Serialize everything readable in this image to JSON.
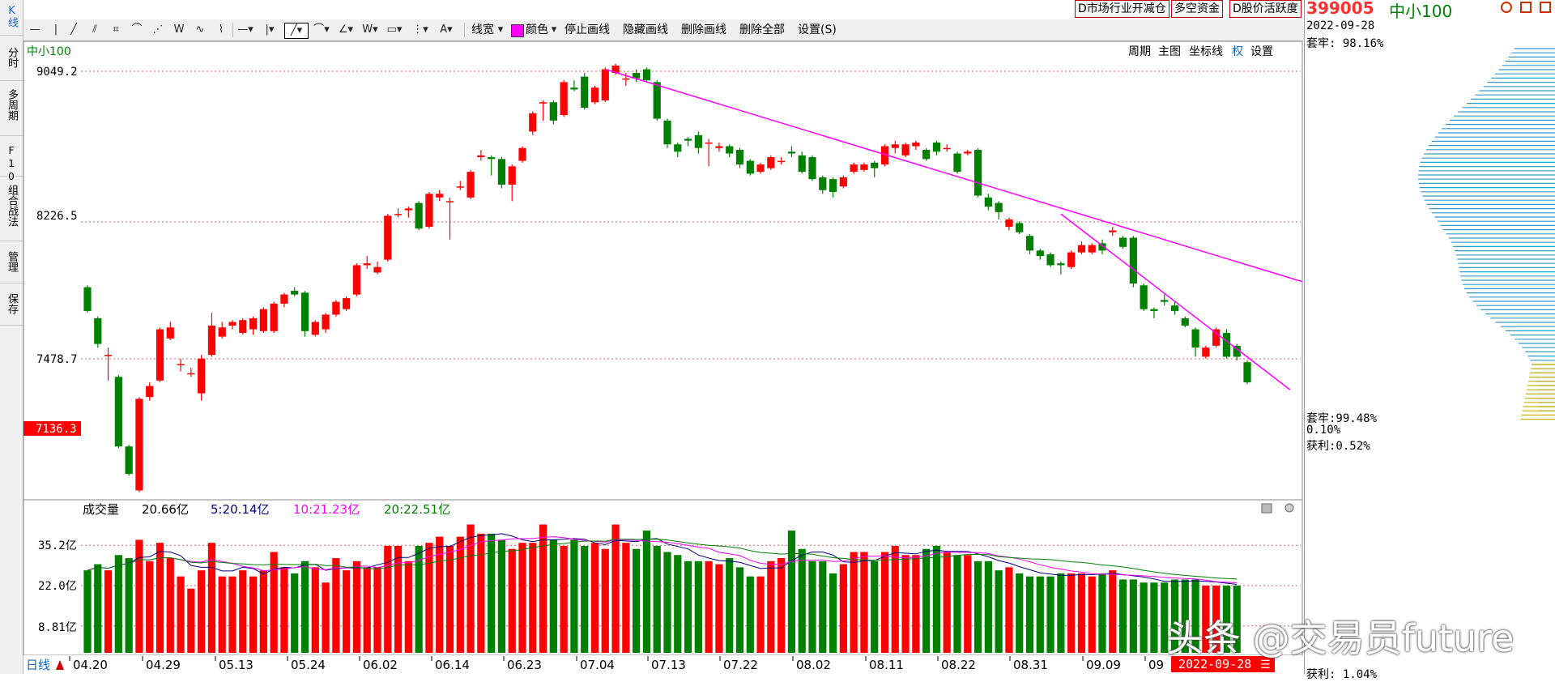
{
  "left_sidebar": {
    "items": [
      {
        "label": "K线"
      },
      {
        "label": "分时"
      },
      {
        "label": "多周期"
      },
      {
        "label": "F10"
      },
      {
        "label": "组合战法"
      },
      {
        "label": "管理"
      },
      {
        "label": "保存"
      }
    ]
  },
  "top_buttons": [
    "D市场行业开减仓",
    "多空资金",
    "D股价活跃度"
  ],
  "toolbar": {
    "icons": [
      "horizontal-line-icon",
      "vertical-line-icon",
      "diagonal-line-icon",
      "parallel-lines-icon",
      "rectangle-channel-icon",
      "arc-icon",
      "fibonacci-fan-icon",
      "w-pattern-icon",
      "wave-pattern-icon",
      "zigzag-icon",
      "line-style-icon",
      "vertical-tick-icon",
      "trend-line-icon",
      "curve-icon",
      "angle-icon",
      "w-icon",
      "rect-icon",
      "speed-lines-icon",
      "text-a-icon"
    ],
    "line_width_label": "线宽",
    "color_label": "颜色",
    "color_value": "#ff00ff",
    "stop_draw_label": "停止画线",
    "hide_draw_label": "隐藏画线",
    "delete_draw_label": "删除画线",
    "delete_all_label": "删除全部",
    "settings_label": "设置(S)"
  },
  "chart_header": {
    "name": "中小100",
    "menu": [
      "周期",
      "主图",
      "坐标线",
      "权",
      "设置"
    ]
  },
  "price_axis": {
    "labels": [
      "9049.2",
      "8226.5",
      "7478.7"
    ],
    "current_tag": "7136.3"
  },
  "volume_header": {
    "label": "成交量",
    "vol": "20.66亿",
    "ma5": "5:20.14亿",
    "ma10": "10:21.23亿",
    "ma20": "20:22.51亿"
  },
  "volume_axis": {
    "labels": [
      "35.2亿",
      "22.0亿",
      "8.81亿"
    ]
  },
  "date_axis": {
    "period_label": "日线",
    "dates": [
      "04.20",
      "04.29",
      "05.13",
      "05.24",
      "06.02",
      "06.14",
      "06.23",
      "07.04",
      "07.13",
      "07.22",
      "08.02",
      "08.11",
      "08.22",
      "08.31",
      "09.09",
      "09"
    ],
    "current_date_tag": "2022-09-28"
  },
  "right_panel": {
    "code": "399005",
    "name": "中小100",
    "date": "2022-09-28",
    "trapped_top": "套牢: 98.16%",
    "trapped_mid": "套牢:99.48%",
    "pct_mid": "0.10%",
    "profit_mid": "获利:0.52%",
    "profit_bottom": "获利: 1.04%"
  },
  "watermark": "头条 @交易员future",
  "colors": {
    "up": "#ff0000",
    "down": "#008000",
    "trendline": "#ff00ff",
    "ma5": "#000080",
    "ma10": "#ff00ff",
    "ma20": "#008000",
    "chip": "#3399cc"
  },
  "chart_data": {
    "type": "candlestick",
    "y_ticks": [
      9049.2,
      8226.5,
      7478.7
    ],
    "last_close": 7136.3,
    "candles": [
      {
        "o": 7870,
        "c": 7740,
        "h": 7880,
        "l": 7730
      },
      {
        "o": 7700,
        "c": 7560,
        "h": 7710,
        "l": 7540
      },
      {
        "o": 7500,
        "c": 7500,
        "h": 7540,
        "l": 7360
      },
      {
        "o": 7380,
        "c": 7000,
        "h": 7390,
        "l": 6990
      },
      {
        "o": 7000,
        "c": 6850,
        "h": 7010,
        "l": 6840
      },
      {
        "o": 6760,
        "c": 7260,
        "h": 7270,
        "l": 6750
      },
      {
        "o": 7270,
        "c": 7330,
        "h": 7350,
        "l": 7250
      },
      {
        "o": 7360,
        "c": 7640,
        "h": 7650,
        "l": 7350
      },
      {
        "o": 7590,
        "c": 7650,
        "h": 7680,
        "l": 7580
      },
      {
        "o": 7450,
        "c": 7450,
        "h": 7480,
        "l": 7410
      },
      {
        "o": 7400,
        "c": 7400,
        "h": 7430,
        "l": 7380
      },
      {
        "o": 7290,
        "c": 7480,
        "h": 7500,
        "l": 7250
      },
      {
        "o": 7500,
        "c": 7660,
        "h": 7730,
        "l": 7490
      },
      {
        "o": 7600,
        "c": 7650,
        "h": 7680,
        "l": 7590
      },
      {
        "o": 7660,
        "c": 7680,
        "h": 7690,
        "l": 7640
      },
      {
        "o": 7620,
        "c": 7690,
        "h": 7700,
        "l": 7610
      },
      {
        "o": 7640,
        "c": 7700,
        "h": 7710,
        "l": 7610
      },
      {
        "o": 7630,
        "c": 7750,
        "h": 7760,
        "l": 7620
      },
      {
        "o": 7630,
        "c": 7780,
        "h": 7790,
        "l": 7620
      },
      {
        "o": 7780,
        "c": 7830,
        "h": 7840,
        "l": 7760
      },
      {
        "o": 7850,
        "c": 7830,
        "h": 7870,
        "l": 7820
      },
      {
        "o": 7840,
        "c": 7630,
        "h": 7850,
        "l": 7600
      },
      {
        "o": 7610,
        "c": 7680,
        "h": 7690,
        "l": 7600
      },
      {
        "o": 7640,
        "c": 7720,
        "h": 7730,
        "l": 7620
      },
      {
        "o": 7720,
        "c": 7790,
        "h": 7800,
        "l": 7710
      },
      {
        "o": 7750,
        "c": 7810,
        "h": 7820,
        "l": 7740
      },
      {
        "o": 7830,
        "c": 7990,
        "h": 8000,
        "l": 7820
      },
      {
        "o": 7990,
        "c": 8000,
        "h": 8040,
        "l": 7970
      },
      {
        "o": 7950,
        "c": 7980,
        "h": 8010,
        "l": 7940
      },
      {
        "o": 8020,
        "c": 8260,
        "h": 8270,
        "l": 8010
      },
      {
        "o": 8270,
        "c": 8270,
        "h": 8300,
        "l": 8250
      },
      {
        "o": 8290,
        "c": 8300,
        "h": 8310,
        "l": 8250
      },
      {
        "o": 8330,
        "c": 8190,
        "h": 8340,
        "l": 8180
      },
      {
        "o": 8200,
        "c": 8380,
        "h": 8390,
        "l": 8190
      },
      {
        "o": 8360,
        "c": 8380,
        "h": 8400,
        "l": 8340
      },
      {
        "o": 8340,
        "c": 8340,
        "h": 8360,
        "l": 8130
      },
      {
        "o": 8420,
        "c": 8420,
        "h": 8450,
        "l": 8400
      },
      {
        "o": 8360,
        "c": 8500,
        "h": 8510,
        "l": 8350
      },
      {
        "o": 8580,
        "c": 8590,
        "h": 8620,
        "l": 8560
      },
      {
        "o": 8580,
        "c": 8570,
        "h": 8590,
        "l": 8480
      },
      {
        "o": 8570,
        "c": 8430,
        "h": 8580,
        "l": 8410
      },
      {
        "o": 8430,
        "c": 8530,
        "h": 8540,
        "l": 8340
      },
      {
        "o": 8560,
        "c": 8630,
        "h": 8640,
        "l": 8550
      },
      {
        "o": 8720,
        "c": 8820,
        "h": 8830,
        "l": 8700
      },
      {
        "o": 8880,
        "c": 8880,
        "h": 8890,
        "l": 8780
      },
      {
        "o": 8880,
        "c": 8780,
        "h": 8890,
        "l": 8760
      },
      {
        "o": 8810,
        "c": 8990,
        "h": 9000,
        "l": 8800
      },
      {
        "o": 8960,
        "c": 8950,
        "h": 9000,
        "l": 8940
      },
      {
        "o": 9020,
        "c": 8850,
        "h": 9040,
        "l": 8840
      },
      {
        "o": 8880,
        "c": 8960,
        "h": 8970,
        "l": 8870
      },
      {
        "o": 8890,
        "c": 9060,
        "h": 9070,
        "l": 8880
      },
      {
        "o": 9040,
        "c": 9080,
        "h": 9090,
        "l": 9030
      },
      {
        "o": 9010,
        "c": 9010,
        "h": 9040,
        "l": 8970
      },
      {
        "o": 9040,
        "c": 9010,
        "h": 9060,
        "l": 8990
      },
      {
        "o": 9060,
        "c": 9000,
        "h": 9070,
        "l": 8990
      },
      {
        "o": 8990,
        "c": 8790,
        "h": 9000,
        "l": 8780
      },
      {
        "o": 8780,
        "c": 8650,
        "h": 8790,
        "l": 8630
      },
      {
        "o": 8650,
        "c": 8610,
        "h": 8660,
        "l": 8580
      },
      {
        "o": 8680,
        "c": 8670,
        "h": 8690,
        "l": 8640
      },
      {
        "o": 8700,
        "c": 8630,
        "h": 8720,
        "l": 8600
      },
      {
        "o": 8660,
        "c": 8660,
        "h": 8680,
        "l": 8530
      },
      {
        "o": 8630,
        "c": 8640,
        "h": 8660,
        "l": 8610
      },
      {
        "o": 8640,
        "c": 8600,
        "h": 8650,
        "l": 8580
      },
      {
        "o": 8620,
        "c": 8540,
        "h": 8630,
        "l": 8520
      },
      {
        "o": 8560,
        "c": 8490,
        "h": 8570,
        "l": 8480
      },
      {
        "o": 8500,
        "c": 8540,
        "h": 8550,
        "l": 8490
      },
      {
        "o": 8520,
        "c": 8580,
        "h": 8590,
        "l": 8510
      },
      {
        "o": 8560,
        "c": 8560,
        "h": 8580,
        "l": 8540
      },
      {
        "o": 8610,
        "c": 8600,
        "h": 8640,
        "l": 8580
      },
      {
        "o": 8590,
        "c": 8500,
        "h": 8610,
        "l": 8490
      },
      {
        "o": 8580,
        "c": 8460,
        "h": 8590,
        "l": 8450
      },
      {
        "o": 8470,
        "c": 8400,
        "h": 8480,
        "l": 8380
      },
      {
        "o": 8460,
        "c": 8390,
        "h": 8470,
        "l": 8360
      },
      {
        "o": 8420,
        "c": 8470,
        "h": 8480,
        "l": 8410
      },
      {
        "o": 8500,
        "c": 8540,
        "h": 8550,
        "l": 8490
      },
      {
        "o": 8510,
        "c": 8540,
        "h": 8550,
        "l": 8500
      },
      {
        "o": 8550,
        "c": 8520,
        "h": 8560,
        "l": 8470
      },
      {
        "o": 8540,
        "c": 8640,
        "h": 8650,
        "l": 8530
      },
      {
        "o": 8630,
        "c": 8650,
        "h": 8670,
        "l": 8600
      },
      {
        "o": 8590,
        "c": 8650,
        "h": 8660,
        "l": 8580
      },
      {
        "o": 8640,
        "c": 8660,
        "h": 8670,
        "l": 8620
      },
      {
        "o": 8620,
        "c": 8570,
        "h": 8630,
        "l": 8560
      },
      {
        "o": 8660,
        "c": 8610,
        "h": 8670,
        "l": 8590
      },
      {
        "o": 8630,
        "c": 8630,
        "h": 8650,
        "l": 8610
      },
      {
        "o": 8600,
        "c": 8500,
        "h": 8610,
        "l": 8490
      },
      {
        "o": 8600,
        "c": 8610,
        "h": 8620,
        "l": 8590
      },
      {
        "o": 8620,
        "c": 8370,
        "h": 8630,
        "l": 8360
      },
      {
        "o": 8360,
        "c": 8310,
        "h": 8380,
        "l": 8290
      },
      {
        "o": 8330,
        "c": 8280,
        "h": 8340,
        "l": 8240
      },
      {
        "o": 8200,
        "c": 8240,
        "h": 8250,
        "l": 8180
      },
      {
        "o": 8220,
        "c": 8170,
        "h": 8230,
        "l": 8160
      },
      {
        "o": 8150,
        "c": 8070,
        "h": 8160,
        "l": 8050
      },
      {
        "o": 8070,
        "c": 8040,
        "h": 8080,
        "l": 8020
      },
      {
        "o": 8050,
        "c": 7990,
        "h": 8060,
        "l": 7980
      },
      {
        "o": 8000,
        "c": 7990,
        "h": 8010,
        "l": 7940
      },
      {
        "o": 7980,
        "c": 8060,
        "h": 8070,
        "l": 7970
      },
      {
        "o": 8060,
        "c": 8100,
        "h": 8120,
        "l": 8050
      },
      {
        "o": 8060,
        "c": 8100,
        "h": 8110,
        "l": 8050
      },
      {
        "o": 8110,
        "c": 8070,
        "h": 8130,
        "l": 8050
      },
      {
        "o": 8170,
        "c": 8180,
        "h": 8200,
        "l": 8150
      },
      {
        "o": 8140,
        "c": 8090,
        "h": 8150,
        "l": 8080
      },
      {
        "o": 8140,
        "c": 7890,
        "h": 8150,
        "l": 7870
      },
      {
        "o": 7880,
        "c": 7750,
        "h": 7890,
        "l": 7740
      },
      {
        "o": 7750,
        "c": 7740,
        "h": 7760,
        "l": 7700
      },
      {
        "o": 7800,
        "c": 7790,
        "h": 7830,
        "l": 7770
      },
      {
        "o": 7770,
        "c": 7740,
        "h": 7790,
        "l": 7720
      },
      {
        "o": 7700,
        "c": 7660,
        "h": 7710,
        "l": 7650
      },
      {
        "o": 7640,
        "c": 7540,
        "h": 7650,
        "l": 7490
      },
      {
        "o": 7490,
        "c": 7540,
        "h": 7550,
        "l": 7480
      },
      {
        "o": 7550,
        "c": 7640,
        "h": 7650,
        "l": 7540
      },
      {
        "o": 7620,
        "c": 7490,
        "h": 7640,
        "l": 7480
      },
      {
        "o": 7550,
        "c": 7490,
        "h": 7560,
        "l": 7470
      },
      {
        "o": 7460,
        "c": 7350,
        "h": 7470,
        "l": 7340
      }
    ],
    "volumes_yi": [
      27,
      29,
      27,
      32,
      31,
      37,
      30,
      36,
      31,
      25,
      21,
      27,
      36,
      25,
      25,
      27,
      25,
      27,
      33,
      28,
      26,
      30,
      28,
      23,
      31,
      27,
      30,
      28,
      28,
      35,
      35,
      30,
      35,
      36,
      38,
      35,
      38,
      42,
      39,
      39,
      37,
      34,
      36,
      36,
      42,
      37,
      35,
      37,
      35,
      36,
      34,
      42,
      36,
      34,
      40,
      35,
      33,
      32,
      30,
      30,
      30,
      29,
      31,
      28,
      25,
      25,
      30,
      31,
      40,
      34,
      30,
      30,
      26,
      29,
      33,
      33,
      30,
      33,
      35,
      32,
      32,
      34,
      35,
      33,
      32,
      32,
      30,
      30,
      27,
      28,
      26,
      25,
      25,
      25,
      26,
      26,
      26,
      25,
      26,
      27,
      24,
      24,
      23,
      23,
      23,
      24,
      24,
      24,
      22,
      22,
      22,
      22
    ]
  }
}
